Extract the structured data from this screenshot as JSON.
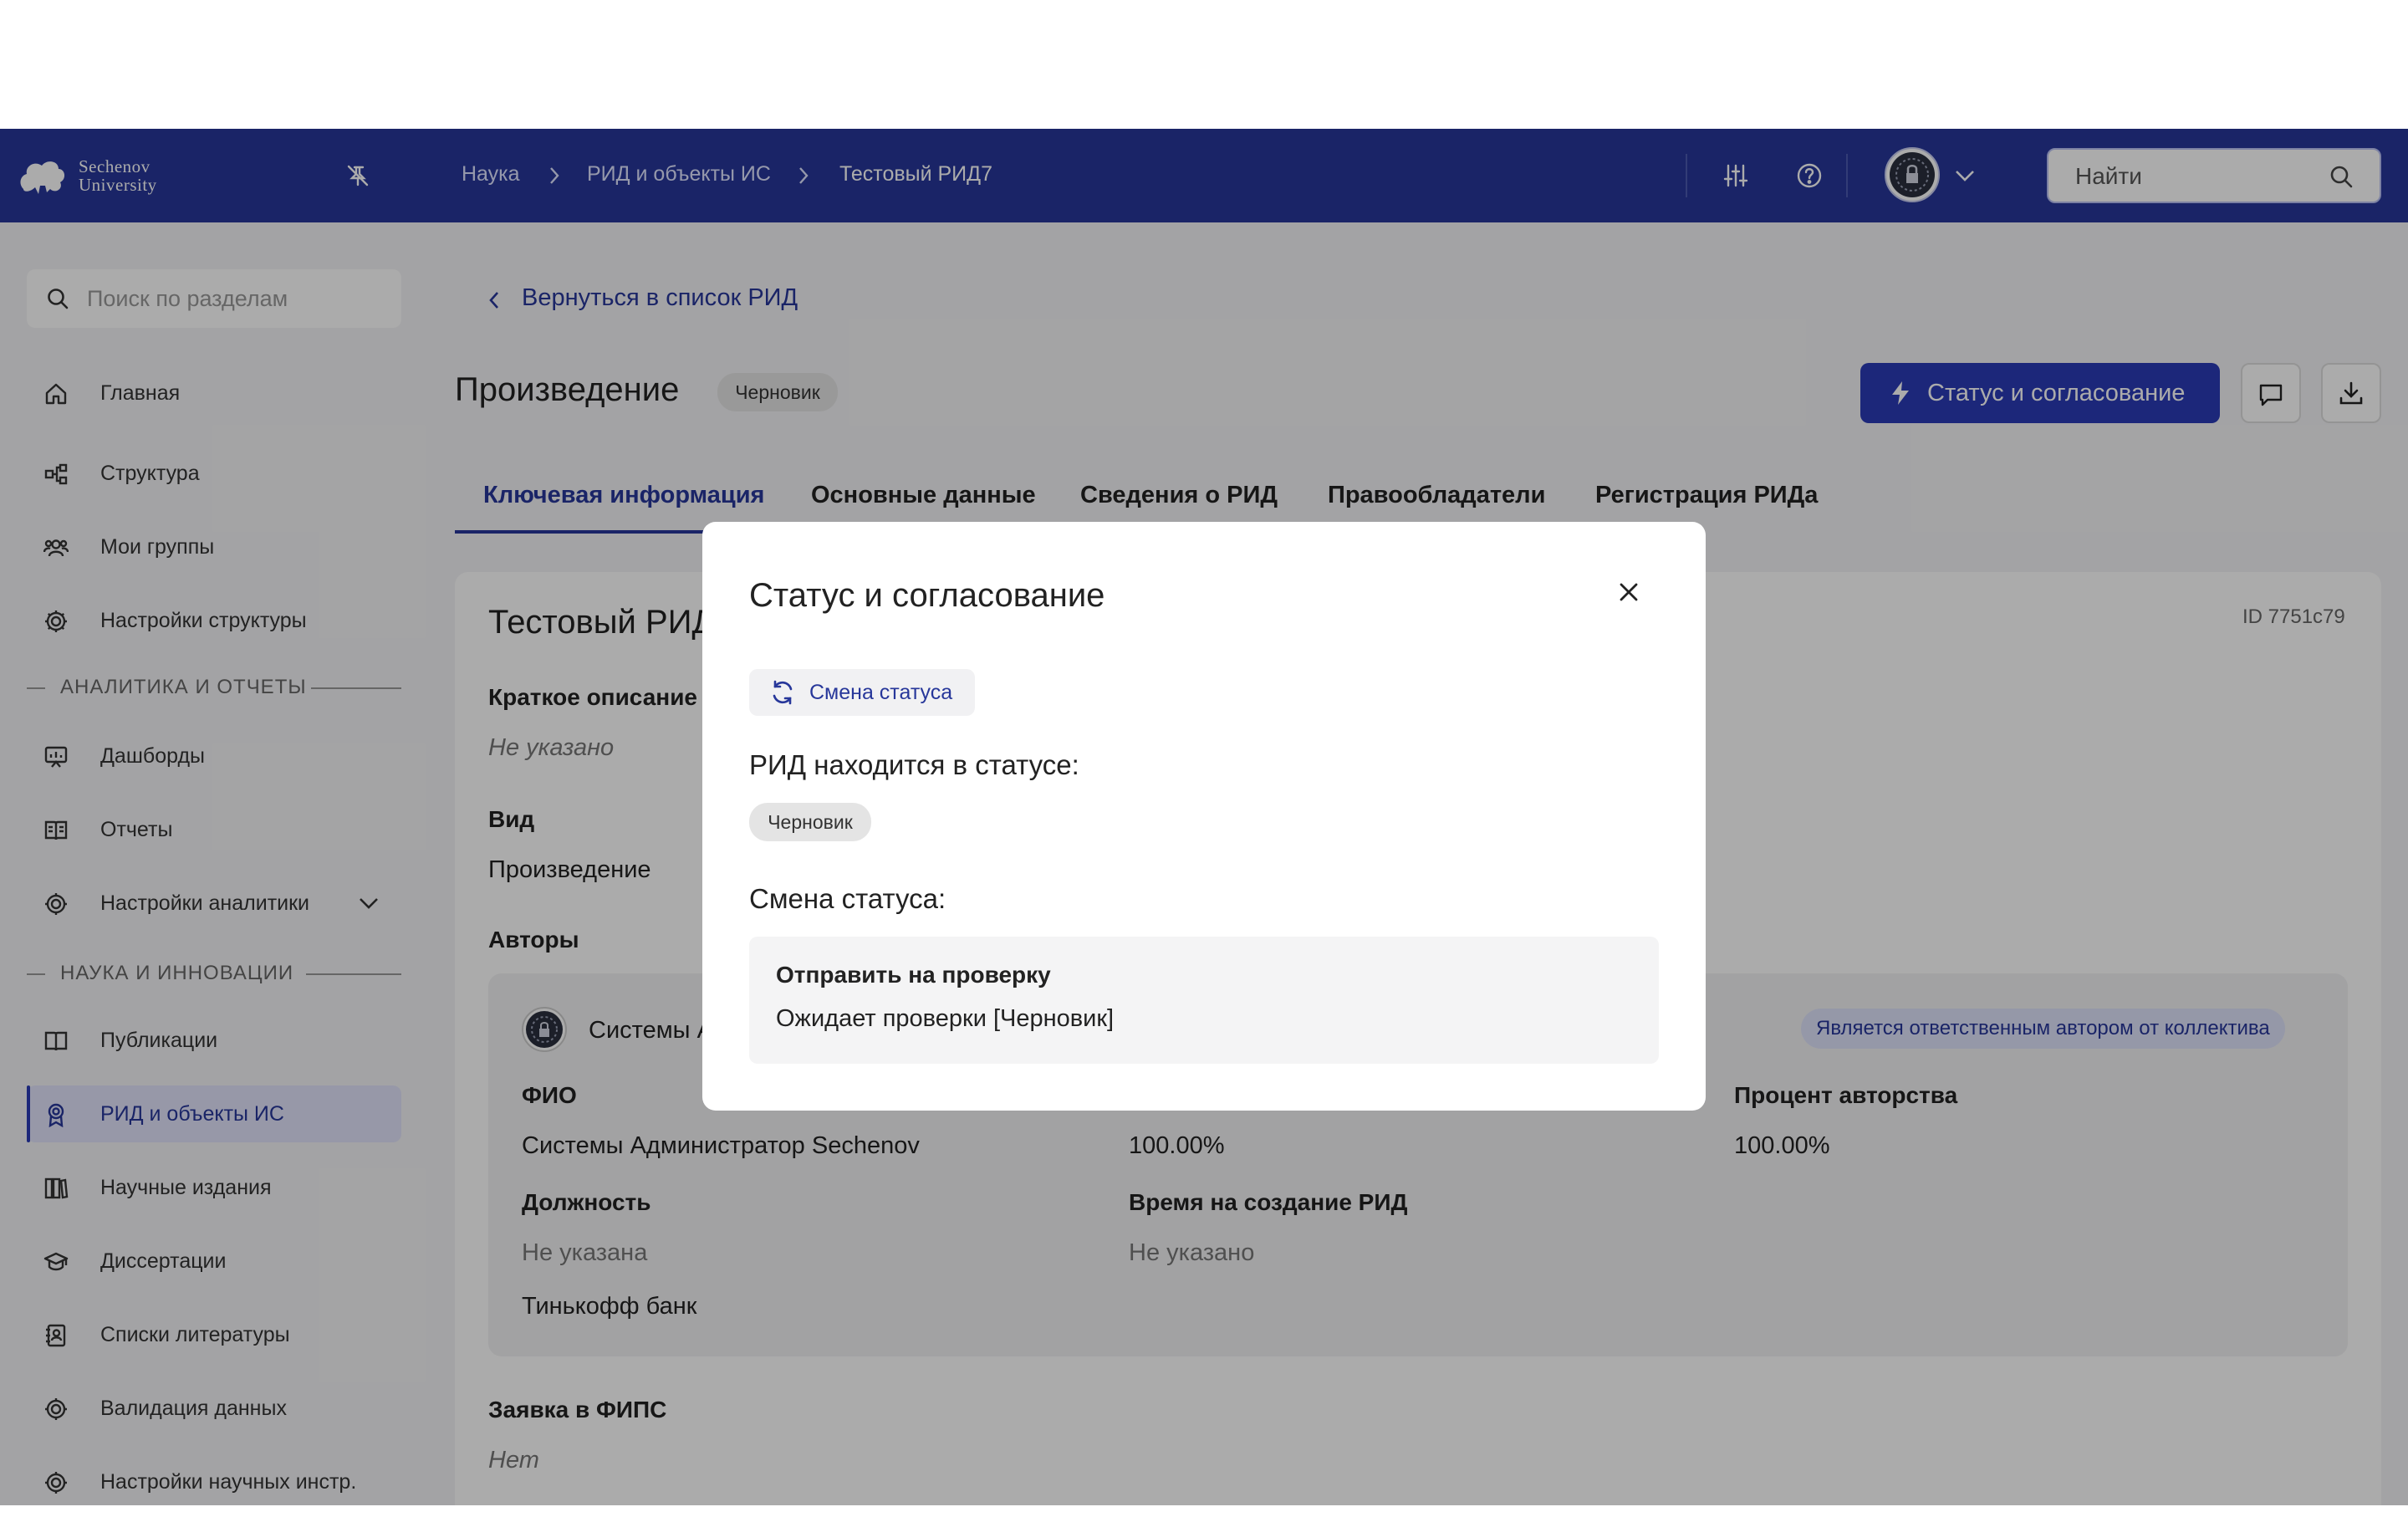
{
  "header": {
    "logo_line1": "Sechenov",
    "logo_line2": "University",
    "breadcrumbs": [
      "Наука",
      "РИД и объекты ИС",
      "Тестовый РИД7"
    ],
    "search_placeholder": "Найти"
  },
  "sidebar": {
    "search_placeholder": "Поиск по разделам",
    "items_top": [
      {
        "label": "Главная",
        "icon": "home-icon"
      },
      {
        "label": "Структура",
        "icon": "structure-icon"
      },
      {
        "label": "Мои группы",
        "icon": "groups-icon"
      },
      {
        "label": "Настройки структуры",
        "icon": "gear-icon"
      }
    ],
    "section_analytics": "АНАЛИТИКА И ОТЧЕТЫ",
    "items_analytics": [
      {
        "label": "Дашборды",
        "icon": "dashboard-icon"
      },
      {
        "label": "Отчеты",
        "icon": "reports-icon"
      },
      {
        "label": "Настройки аналитики",
        "icon": "gear-icon"
      }
    ],
    "section_science": "НАУКА И ИННОВАЦИИ",
    "items_science": [
      {
        "label": "Публикации",
        "icon": "book-icon"
      },
      {
        "label": "РИД и объекты ИС",
        "icon": "award-icon",
        "active": true
      },
      {
        "label": "Научные издания",
        "icon": "journals-icon"
      },
      {
        "label": "Диссертации",
        "icon": "graduation-cap-icon"
      },
      {
        "label": "Списки литературы",
        "icon": "contact-book-icon"
      },
      {
        "label": "Валидация данных",
        "icon": "gear-icon"
      },
      {
        "label": "Настройки научных инстр.",
        "icon": "gear-icon"
      }
    ]
  },
  "page": {
    "back_link": "Вернуться в список РИД",
    "title": "Произведение",
    "status_badge": "Черновик",
    "primary_button": "Статус и согласование",
    "tabs": [
      "Ключевая информация",
      "Основные данные",
      "Сведения о РИД",
      "Правообладатели",
      "Регистрация РИДа"
    ],
    "active_tab": "Ключевая информация"
  },
  "card": {
    "title": "Тестовый РИД7",
    "id_text": "ID 7751c79",
    "short_desc_label": "Краткое описание",
    "short_desc_value": "Не указано",
    "type_label": "Вид",
    "type_value": "Произведение",
    "authors_label": "Авторы",
    "author": {
      "name_short": "Системы Администратор Sechenov",
      "responsible_badge": "Является ответственным автором от коллектива",
      "fio_label": "ФИО",
      "fio_value": "Системы Администратор Sechenov",
      "share_value": "100.00%",
      "percent_label": "Процент авторства",
      "percent_value": "100.00%",
      "position_label": "Должность",
      "position_value": "Не указана",
      "time_label": "Время на создание РИД",
      "time_value": "Не указано",
      "org_value": "Тинькофф банк"
    },
    "fips_label": "Заявка в ФИПС",
    "fips_value": "Нет"
  },
  "modal": {
    "title": "Статус и согласование",
    "change_chip": "Смена статуса",
    "current_status_label": "РИД находится в статусе:",
    "current_status_badge": "Черновик",
    "change_status_label": "Смена статуса:",
    "option_title": "Отправить на проверку",
    "option_subtitle": "Ожидает проверки [Черновик]"
  },
  "colors": {
    "header_bg": "#27379a",
    "primary": "#2a3bb6",
    "active_nav_bg": "#e1e3fb"
  }
}
